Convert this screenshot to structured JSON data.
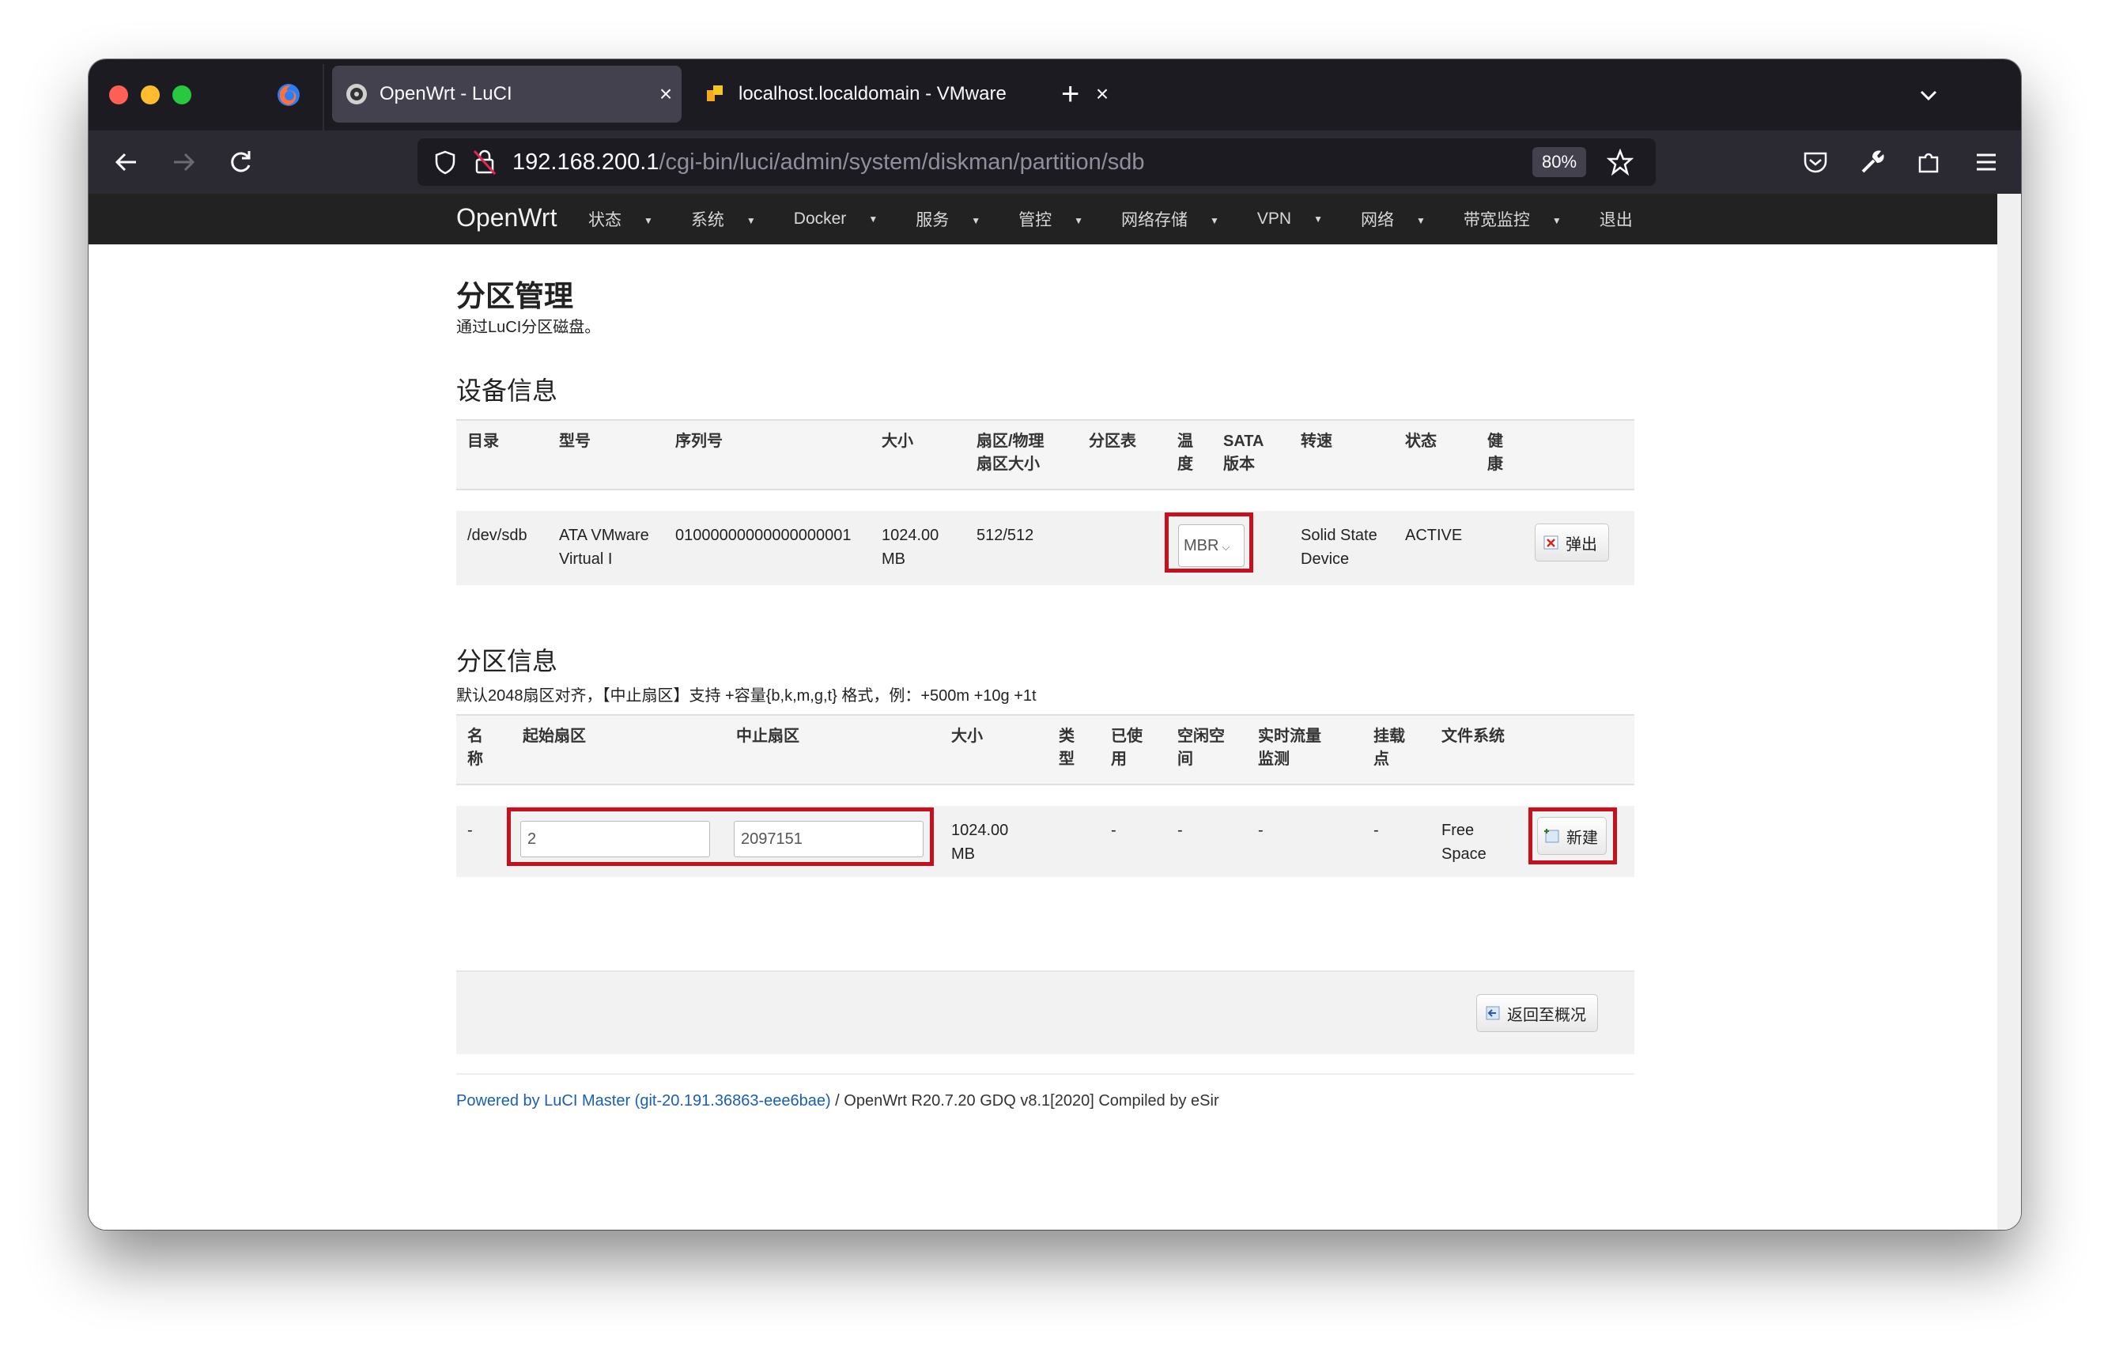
{
  "browser": {
    "tabs": [
      {
        "title": "OpenWrt - LuCI",
        "close": "×"
      },
      {
        "title": "localhost.localdomain - VMware",
        "close": "×"
      }
    ],
    "new_tab": "+",
    "url_host": "192.168.200.1",
    "url_path": "/cgi-bin/luci/admin/system/diskman/partition/sdb",
    "zoom": "80%"
  },
  "luci": {
    "brand": "OpenWrt",
    "menu": [
      "状态",
      "系统",
      "Docker",
      "服务",
      "管控",
      "网络存储",
      "VPN",
      "网络",
      "带宽监控",
      "退出"
    ]
  },
  "page": {
    "title": "分区管理",
    "description": "通过LuCI分区磁盘。"
  },
  "device_section": {
    "title": "设备信息",
    "headers": [
      "目录",
      "型号",
      "序列号",
      "大小",
      "扇区/物理\n扇区大小",
      "分区表",
      "温\n度",
      "SATA\n版本",
      "转速",
      "状态",
      "健\n康"
    ],
    "row": {
      "path": "/dev/sdb",
      "model": "ATA VMware\nVirtual I",
      "serial": "01000000000000000001",
      "size": "1024.00\nMB",
      "sector": "512/512",
      "partition_table": "MBR",
      "temperature": "",
      "sata": "",
      "rotation": "Solid State\nDevice",
      "status": "ACTIVE",
      "health": ""
    },
    "eject_button": "弹出"
  },
  "partition_section": {
    "title": "分区信息",
    "note": "默认2048扇区对齐，【中止扇区】支持 +容量{b,k,m,g,t} 格式，例：+500m +10g +1t",
    "headers": [
      "名\n称",
      "起始扇区",
      "中止扇区",
      "大小",
      "类\n型",
      "已使\n用",
      "空闲空\n间",
      "实时流量\n监测",
      "挂载\n点",
      "文件系统"
    ],
    "row": {
      "name": "-",
      "start_sector": "2",
      "end_sector": "2097151",
      "size": "1024.00\nMB",
      "type": "",
      "used": "-",
      "free": "-",
      "traffic": "-",
      "mount": "-",
      "filesystem": "Free\nSpace"
    },
    "new_button": "新建"
  },
  "back_button": "返回至概况",
  "footer": {
    "link": "Powered by LuCI Master (git-20.191.36863-eee6bae)",
    "text": " / OpenWrt R20.7.20 GDQ v8.1[2020] Compiled by eSir"
  },
  "colors": {
    "highlight": "#c8101c",
    "link": "#1a5fb4",
    "nav_bg": "#222222"
  }
}
